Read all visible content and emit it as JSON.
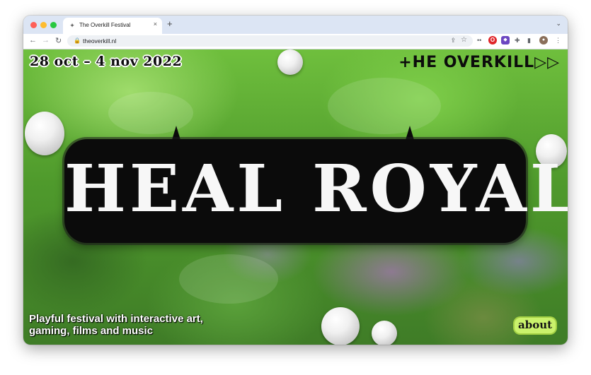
{
  "browser": {
    "tab_title": "The Overkill Festival",
    "tab_close": "×",
    "new_tab": "+",
    "tab_menu": "⌄",
    "url": "theoverkill.nl",
    "icons": [
      "back-icon",
      "forward-icon",
      "reload-icon",
      "lock-icon",
      "share-icon",
      "bookmark-star-icon",
      "extensions-icon",
      "menu-icon"
    ]
  },
  "hero": {
    "dates": "28 oct – 4 nov 2022",
    "logo": "+HE OVERKILL▷▷",
    "title": "HEAL ROYALE",
    "tagline": "Playful festival with interactive art, gaming, films and music",
    "about_label": "about"
  }
}
